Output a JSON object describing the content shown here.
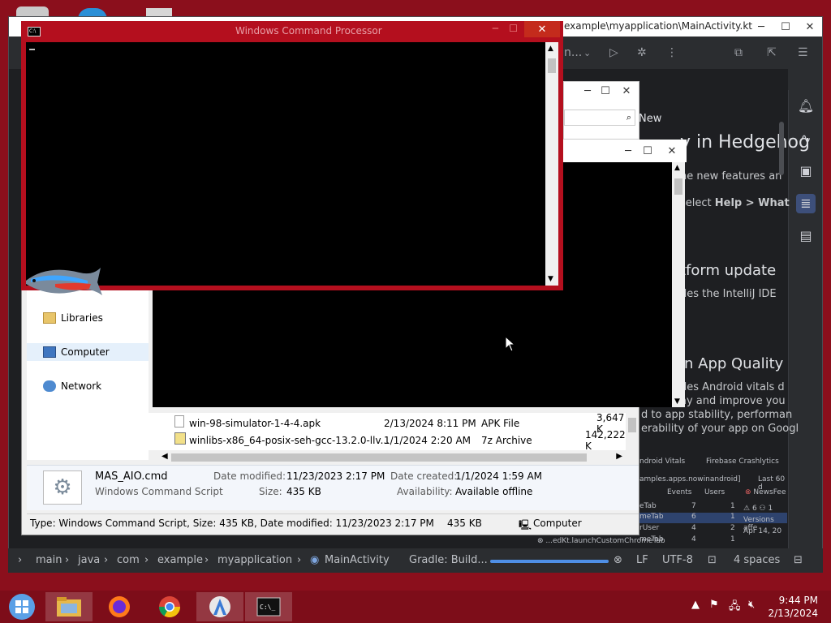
{
  "ide": {
    "title": "example\\myapplication\\MainActivity.kt",
    "toolbar_config": "n...",
    "whatsnew_tab": "New",
    "headline": "y in Hedgehog",
    "line1": "he new features an",
    "line2_prefix": "select ",
    "line2_bold": "Help > What",
    "section1": "tform update",
    "section1_text": "des the IntelliJ IDE",
    "section2": "in App Quality",
    "section2_text1": "des Android vitals d",
    "section2_text2": "ay and improve you",
    "section2_text3": "d to app stability, performan",
    "section2_text4": "erability of your app on Googl",
    "vitals": {
      "tab1": "ndroid Vitals",
      "tab2": "Firebase Crashlytics",
      "filter": "amples.apps.nowinandroid]",
      "range": "Last 60 d",
      "col_events": "Events",
      "col_users": "Users",
      "issue": "NewsFee",
      "rows": [
        {
          "name": "eTab",
          "events": "7",
          "users": "1"
        },
        {
          "name": "meTab",
          "events": "6",
          "users": "1"
        },
        {
          "name": "rUser",
          "events": "4",
          "users": "2"
        },
        {
          "name": "meTab",
          "events": "4",
          "users": "1"
        }
      ],
      "stat1": "6",
      "stat2": "1",
      "versions": "Versions affe",
      "date": "Apr 14, 20",
      "func": "...edKt.launchCustomChromeTab"
    },
    "statusbar": {
      "crumbs": [
        "main",
        "java",
        "com",
        "example",
        "myapplication"
      ],
      "class": "MainActivity",
      "gradle": "Gradle: Build...",
      "progress": 1.0,
      "lf": "LF",
      "encoding": "UTF-8",
      "indent": "4 spaces"
    }
  },
  "cmd": {
    "title": "Windows Command Processor",
    "close": "✕",
    "min": "─",
    "max": "☐"
  },
  "explorer": {
    "nav": [
      {
        "label": "Libraries",
        "icon": "libraries-icon"
      },
      {
        "label": "Computer",
        "icon": "computer-icon"
      },
      {
        "label": "Network",
        "icon": "network-icon"
      }
    ],
    "files": [
      {
        "name": "win-98-simulator-1-4-4.apk",
        "date": "2/13/2024 8:11 PM",
        "type": "APK File",
        "size": "3,647 K"
      },
      {
        "name": "winlibs-x86_64-posix-seh-gcc-13.2.0-llv...",
        "date": "1/1/2024 2:20 AM",
        "type": "7z Archive",
        "size": "142,222 K"
      }
    ],
    "details": {
      "filename": "MAS_AIO.cmd",
      "filetype": "Windows Command Script",
      "date_modified_label": "Date modified:",
      "date_modified": "11/23/2023 2:17 PM",
      "size_label": "Size:",
      "size": "435 KB",
      "date_created_label": "Date created:",
      "date_created": "1/1/2024 1:59 AM",
      "availability_label": "Availability:",
      "availability": "Available offline"
    },
    "status": {
      "text": "Type: Windows Command Script, Size: 435 KB, Date modified: 11/23/2023 2:17 PM",
      "size": "435 KB",
      "location": "Computer"
    }
  },
  "taskbar": {
    "time": "9:44 PM",
    "date": "2/13/2024"
  },
  "colors": {
    "desktop": "#8b0f1c",
    "cmd_frame": "#b40f1e",
    "accent": "#4f8fe6"
  }
}
